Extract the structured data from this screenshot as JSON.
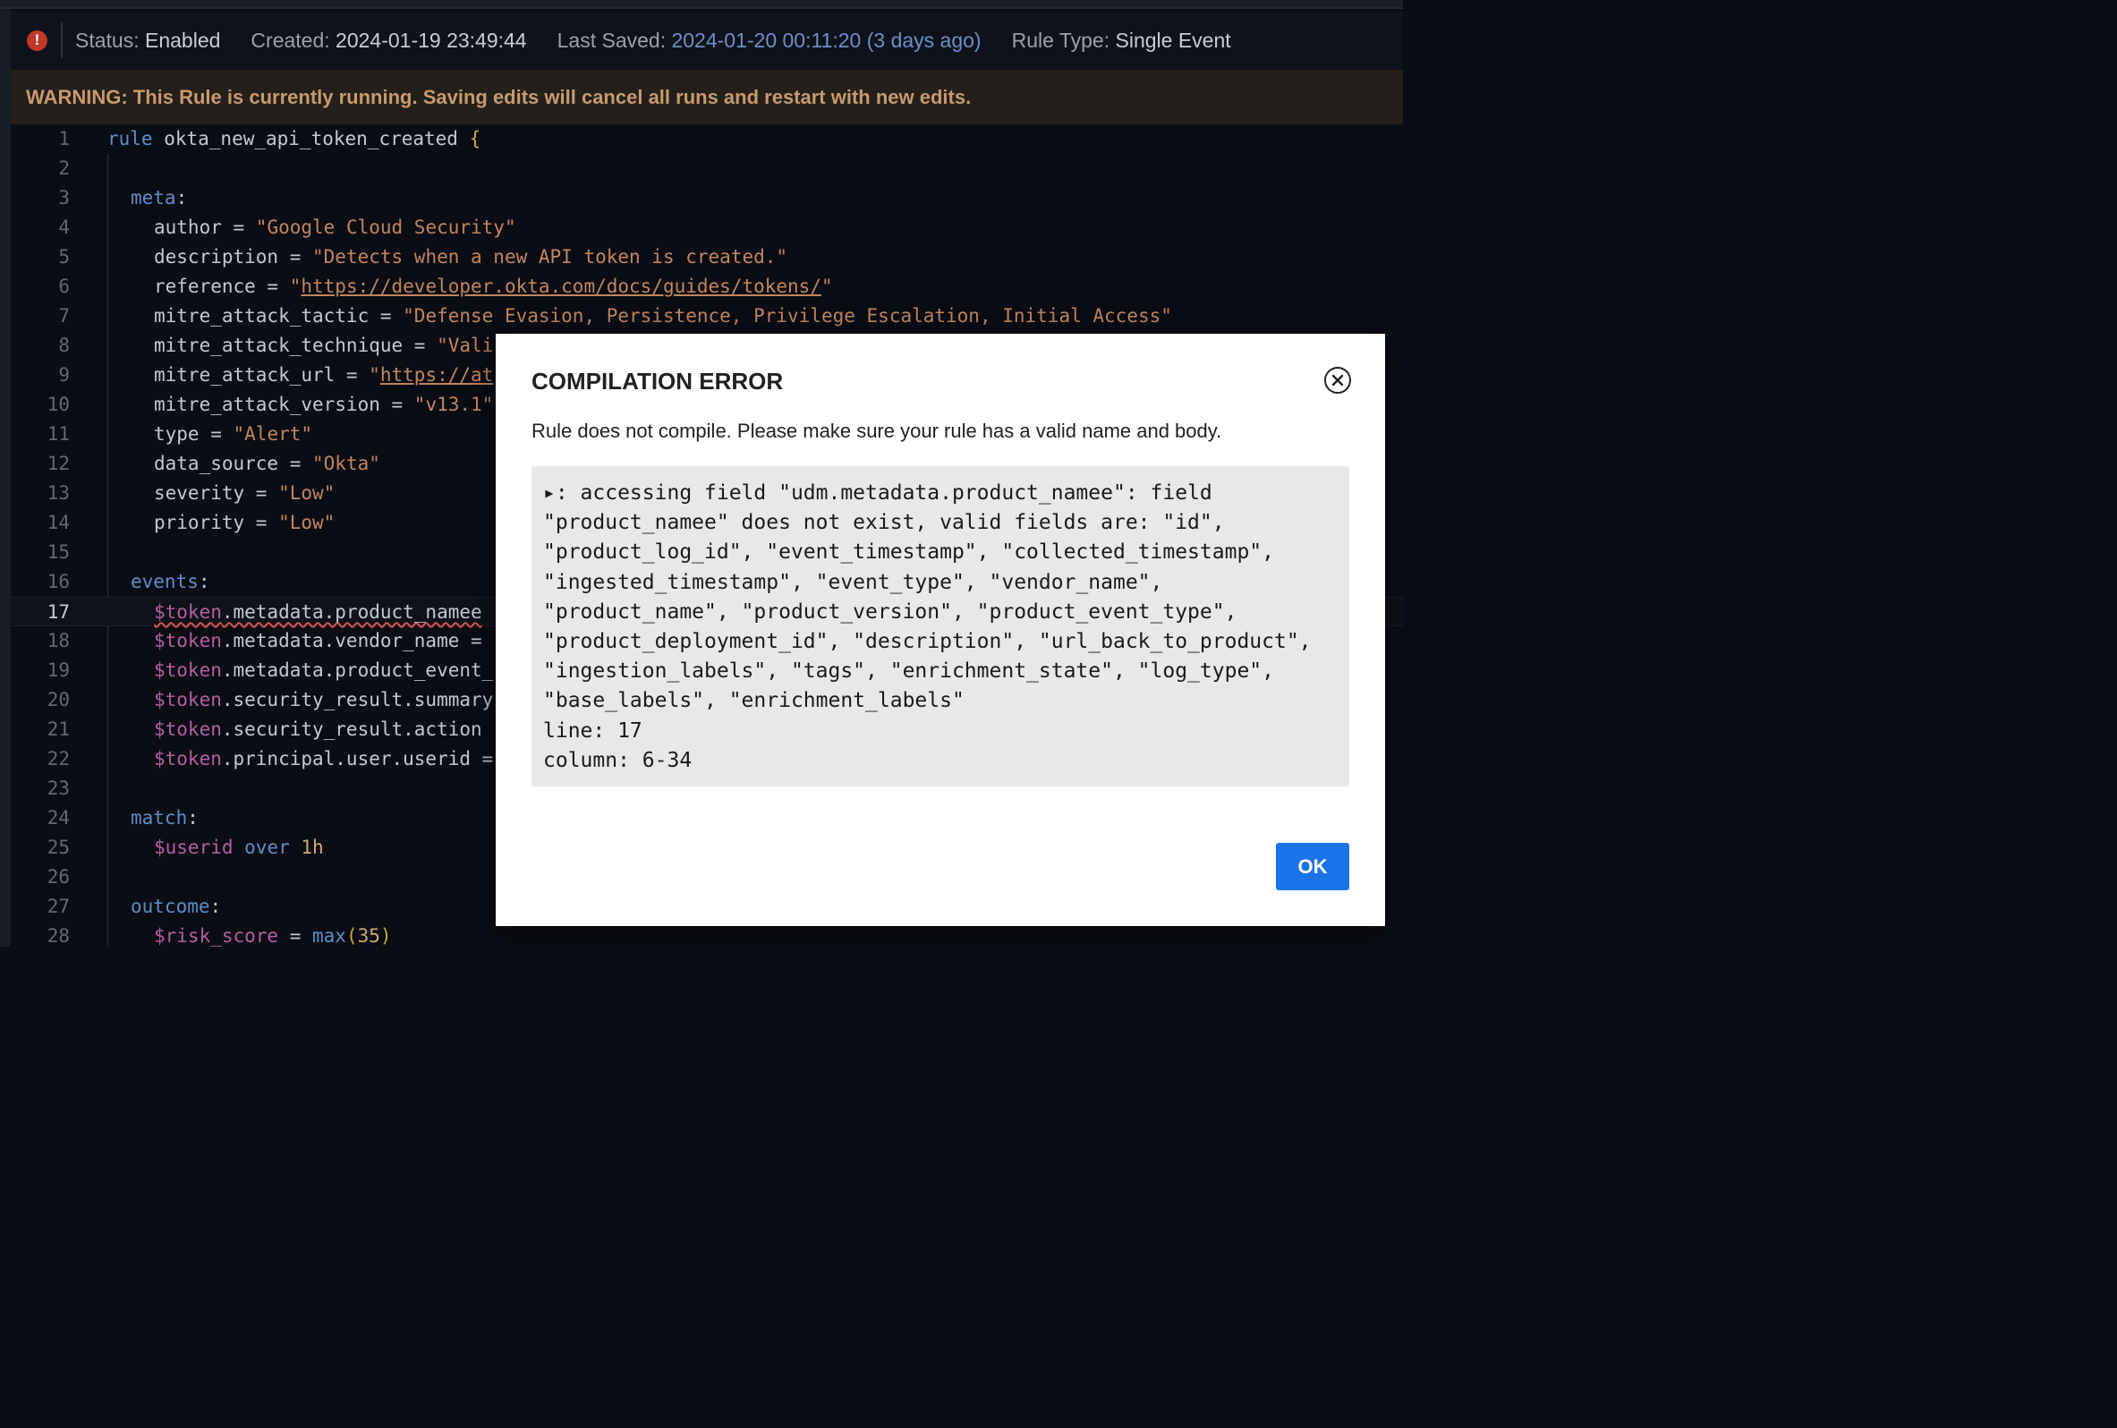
{
  "status_bar": {
    "status_label": "Status:",
    "status_value": "Enabled",
    "created_label": "Created:",
    "created_value": "2024-01-19 23:49:44",
    "saved_label": "Last Saved:",
    "saved_value": "2024-01-20 00:11:20 (3 days ago)",
    "type_label": "Rule Type:",
    "type_value": "Single Event"
  },
  "warning": "WARNING: This Rule is currently running. Saving edits will cancel all runs and restart with new edits.",
  "editor": {
    "active_line": 17,
    "line_numbers": [
      "1",
      "2",
      "3",
      "4",
      "5",
      "6",
      "7",
      "8",
      "9",
      "10",
      "11",
      "12",
      "13",
      "14",
      "15",
      "16",
      "17",
      "18",
      "19",
      "20",
      "21",
      "22",
      "23",
      "24",
      "25",
      "26",
      "27",
      "28"
    ],
    "code": {
      "l1_kw": "rule",
      "l1_name": " okta_new_api_token_created ",
      "l1_brace": "{",
      "l3_kw": "meta",
      "colon": ":",
      "l4_key": "author = ",
      "l4_val": "\"Google Cloud Security\"",
      "l5_key": "description = ",
      "l5_val": "\"Detects when a new API token is created.\"",
      "l6_key": "reference = ",
      "q": "\"",
      "l6_url": "https://developer.okta.com/docs/guides/tokens/",
      "l7_key": "mitre_attack_tactic = ",
      "l7_val": "\"Defense Evasion, Persistence, Privilege Escalation, Initial Access\"",
      "l8_key": "mitre_attack_technique = ",
      "l8_val": "\"Vali",
      "l9_key": "mitre_attack_url = ",
      "l9_url": "https://at",
      "l10_key": "mitre_attack_version = ",
      "l10_val": "\"v13.1\"",
      "l11_key": "type = ",
      "l11_val": "\"Alert\"",
      "l12_key": "data_source = ",
      "l12_val": "\"Okta\"",
      "l13_key": "severity = ",
      "l13_val": "\"Low\"",
      "l14_key": "priority = ",
      "l14_val": "\"Low\"",
      "l16_kw": "events",
      "token": "$token",
      "l17_rest": ".metadata.product_namee",
      "l18_rest": ".metadata.vendor_name =",
      "l19_rest": ".metadata.product_event_",
      "l20_rest": ".security_result.summary",
      "l21_rest": ".security_result.action",
      "l22_rest": ".principal.user.userid =",
      "l24_kw": "match",
      "userid": "$userid",
      "over": " over ",
      "l25_dur": "1h",
      "l27_kw": "outcome",
      "risk": "$risk_score",
      "eq": " = ",
      "max_fn": "max",
      "lp": "(",
      "l28_num": "35",
      "rp": ")"
    }
  },
  "modal": {
    "title": "COMPILATION ERROR",
    "message": "Rule does not compile. Please make sure your rule has a valid name and body.",
    "error_text": "▸: accessing field \"udm.metadata.product_namee\": field\n\"product_namee\" does not exist, valid fields are: \"id\",\n\"product_log_id\", \"event_timestamp\", \"collected_timestamp\",\n\"ingested_timestamp\", \"event_type\", \"vendor_name\",\n\"product_name\", \"product_version\", \"product_event_type\",\n\"product_deployment_id\", \"description\", \"url_back_to_product\",\n\"ingestion_labels\", \"tags\", \"enrichment_state\", \"log_type\",\n\"base_labels\", \"enrichment_labels\"\nline: 17\ncolumn: 6-34",
    "ok_label": "OK"
  },
  "colors": {
    "accent_button": "#1a73e8",
    "warning_text": "#c69b6d",
    "error_icon": "#c0392b"
  }
}
